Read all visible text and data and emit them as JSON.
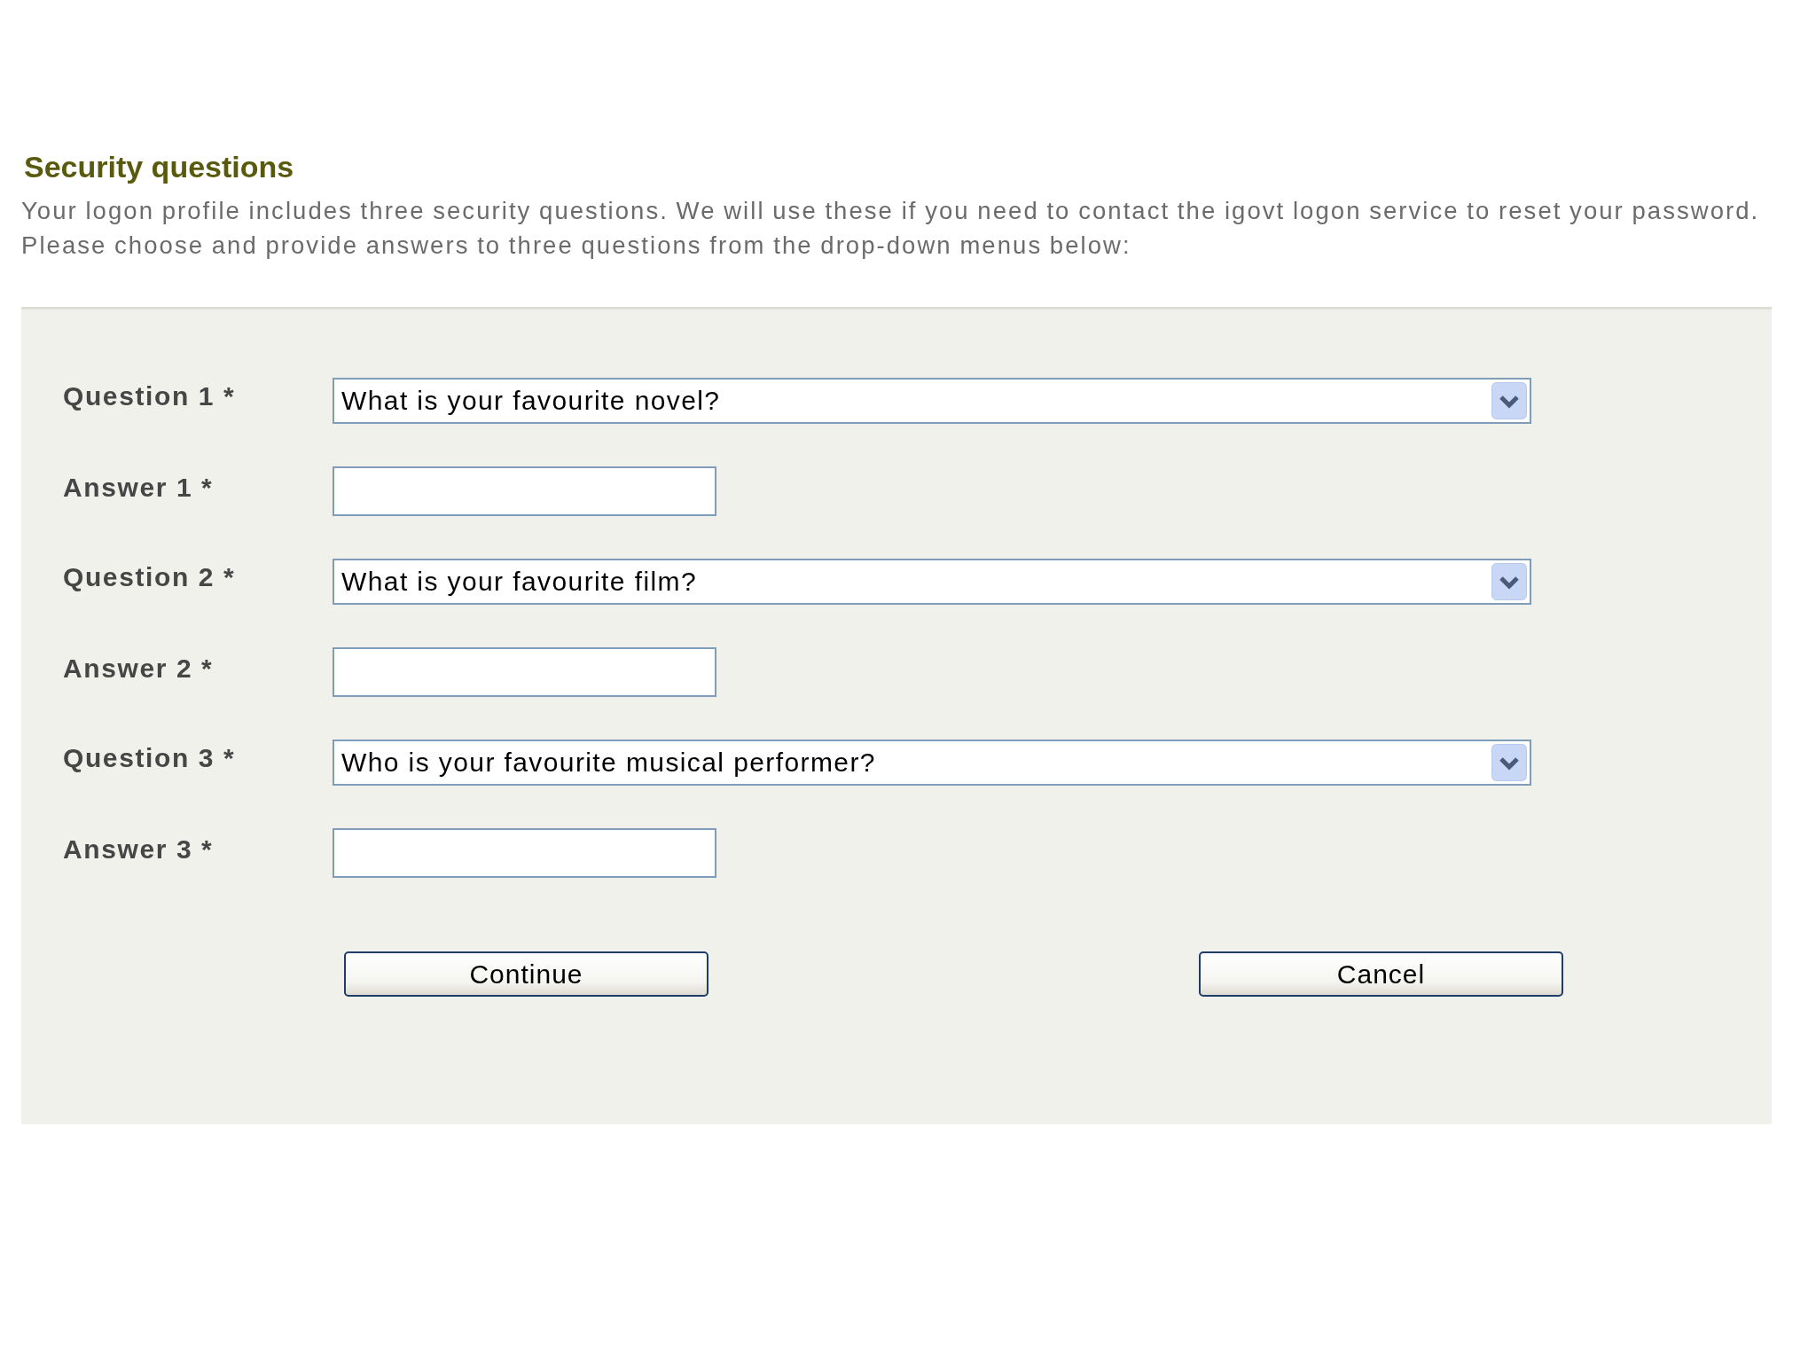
{
  "title": "Security questions",
  "intro": [
    "Your logon profile includes three security questions. We will use these if you need to contact the igovt logon service to reset your password.",
    "Please choose and provide answers to three questions from the drop-down menus below:"
  ],
  "form": {
    "fields": [
      {
        "kind": "select",
        "label": "Question 1 *",
        "value": "What is your favourite novel?"
      },
      {
        "kind": "text",
        "label": "Answer 1 *"
      },
      {
        "kind": "select",
        "label": "Question 2 *",
        "value": "What is your favourite film?"
      },
      {
        "kind": "text",
        "label": "Answer 2 *"
      },
      {
        "kind": "select",
        "label": "Question 3 *",
        "value": "Who is your favourite musical performer?"
      },
      {
        "kind": "text",
        "label": "Answer 3 *"
      }
    ],
    "buttons": [
      "Continue",
      "Cancel"
    ]
  }
}
